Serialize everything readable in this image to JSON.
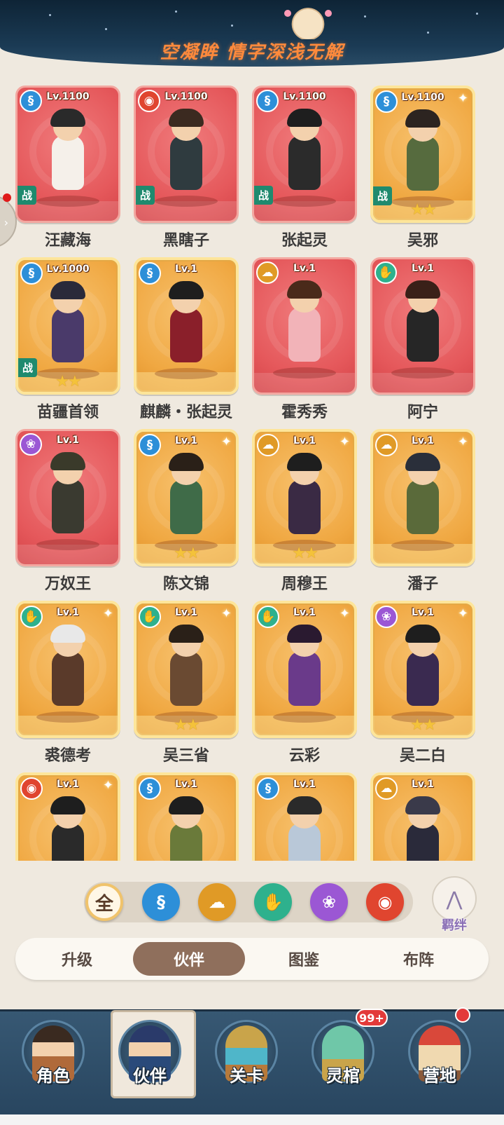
{
  "banner": {
    "title": "空凝眸 情字深浅无解"
  },
  "cards": [
    {
      "name": "汪藏海",
      "level": "Lv.1100",
      "element": "water",
      "bg": "red",
      "battle": true,
      "stars": 0,
      "sparkle": false,
      "hair": "#2a2a2a",
      "outfit": "#f5f0ea"
    },
    {
      "name": "黑瞎子",
      "level": "Lv.1100",
      "element": "fire",
      "bg": "red",
      "battle": true,
      "stars": 0,
      "sparkle": false,
      "hair": "#3b2a20",
      "outfit": "#2f3b3f"
    },
    {
      "name": "张起灵",
      "level": "Lv.1100",
      "element": "water",
      "bg": "red",
      "battle": true,
      "stars": 0,
      "sparkle": false,
      "hair": "#1e1e1e",
      "outfit": "#2b2b2b"
    },
    {
      "name": "吴邪",
      "level": "Lv.1100",
      "element": "water",
      "bg": "gold",
      "battle": true,
      "stars": 2,
      "sparkle": true,
      "hair": "#2c2420",
      "outfit": "#566b3e"
    },
    {
      "name": "苗疆首领",
      "level": "Lv.1000",
      "element": "water",
      "bg": "gold",
      "battle": true,
      "stars": 2,
      "sparkle": false,
      "hair": "#2a2a3a",
      "outfit": "#4a3a6a"
    },
    {
      "name": "麒麟・张起灵",
      "level": "Lv.1",
      "element": "water",
      "bg": "gold",
      "battle": false,
      "stars": 0,
      "sparkle": false,
      "hair": "#1e1e1e",
      "outfit": "#8a1f2a"
    },
    {
      "name": "霍秀秀",
      "level": "Lv.1",
      "element": "earth",
      "bg": "red",
      "battle": false,
      "stars": 0,
      "sparkle": false,
      "hair": "#4a2a1a",
      "outfit": "#f2b3b8"
    },
    {
      "name": "阿宁",
      "level": "Lv.1",
      "element": "wood",
      "bg": "red",
      "battle": false,
      "stars": 0,
      "sparkle": false,
      "hair": "#3a2018",
      "outfit": "#262626"
    },
    {
      "name": "万奴王",
      "level": "Lv.1",
      "element": "spirit",
      "bg": "red",
      "battle": false,
      "stars": 0,
      "sparkle": false,
      "hair": "#3a3a2a",
      "outfit": "#3a3a30"
    },
    {
      "name": "陈文锦",
      "level": "Lv.1",
      "element": "water",
      "bg": "gold",
      "battle": false,
      "stars": 2,
      "sparkle": true,
      "hair": "#2a2018",
      "outfit": "#3f6b48"
    },
    {
      "name": "周穆王",
      "level": "Lv.1",
      "element": "earth",
      "bg": "gold",
      "battle": false,
      "stars": 2,
      "sparkle": true,
      "hair": "#1e1e1e",
      "outfit": "#3a2a44"
    },
    {
      "name": "潘子",
      "level": "Lv.1",
      "element": "earth",
      "bg": "gold",
      "battle": false,
      "stars": 0,
      "sparkle": true,
      "hair": "#2a2f3a",
      "outfit": "#5a6a3a"
    },
    {
      "name": "裘德考",
      "level": "Lv.1",
      "element": "wood",
      "bg": "gold",
      "battle": false,
      "stars": 0,
      "sparkle": true,
      "hair": "#e8e8e8",
      "outfit": "#5a3a2a"
    },
    {
      "name": "吴三省",
      "level": "Lv.1",
      "element": "wood",
      "bg": "gold",
      "battle": false,
      "stars": 2,
      "sparkle": true,
      "hair": "#2a2018",
      "outfit": "#6a4a32"
    },
    {
      "name": "云彩",
      "level": "Lv.1",
      "element": "wood",
      "bg": "gold",
      "battle": false,
      "stars": 0,
      "sparkle": true,
      "hair": "#2a1a30",
      "outfit": "#6a3a8a"
    },
    {
      "name": "吴二白",
      "level": "Lv.1",
      "element": "spirit",
      "bg": "gold",
      "battle": false,
      "stars": 2,
      "sparkle": true,
      "hair": "#1e1e1e",
      "outfit": "#3a2a50"
    },
    {
      "name": "",
      "level": "Lv.1",
      "element": "fire",
      "bg": "gold",
      "battle": false,
      "stars": 0,
      "sparkle": true,
      "hair": "#1e1e1e",
      "outfit": "#2a2a2a"
    },
    {
      "name": "",
      "level": "Lv.1",
      "element": "water",
      "bg": "gold",
      "battle": false,
      "stars": 0,
      "sparkle": false,
      "hair": "#1e1e1e",
      "outfit": "#6a7a3a"
    },
    {
      "name": "",
      "level": "Lv.1",
      "element": "water",
      "bg": "gold",
      "battle": false,
      "stars": 0,
      "sparkle": false,
      "hair": "#2a2a2a",
      "outfit": "#b9c8d8"
    },
    {
      "name": "",
      "level": "Lv.1",
      "element": "earth",
      "bg": "gold",
      "battle": false,
      "stars": 0,
      "sparkle": false,
      "hair": "#3a3a4a",
      "outfit": "#2a2a3a"
    }
  ],
  "card_labels": {
    "battle": "战",
    "star": "★"
  },
  "element_icons": {
    "water": "water-dragon-icon",
    "fire": "fire-swirl-icon",
    "earth": "earth-cloud-icon",
    "wood": "wood-hand-icon",
    "spirit": "spirit-lotus-icon"
  },
  "element_glyphs": {
    "water": "§",
    "fire": "◉",
    "earth": "☁",
    "wood": "✋",
    "spirit": "❀"
  },
  "element_colors": {
    "water": "#2d8fd8",
    "fire": "#e0452f",
    "earth": "#e09a26",
    "wood": "#2eb18d",
    "spirit": "#9b57d4"
  },
  "filter": {
    "all_label": "全",
    "elements": [
      "water",
      "earth",
      "wood",
      "spirit",
      "fire"
    ]
  },
  "bond": {
    "label": "羁绊"
  },
  "subtabs": [
    {
      "label": "升级",
      "active": false
    },
    {
      "label": "伙伴",
      "active": true
    },
    {
      "label": "图鉴",
      "active": false
    },
    {
      "label": "布阵",
      "active": false
    }
  ],
  "bottom_nav": [
    {
      "label": "角色",
      "icon": "character-icon",
      "active": false,
      "badge": "",
      "dot": false
    },
    {
      "label": "伙伴",
      "icon": "partner-icon",
      "active": true,
      "badge": "",
      "dot": false
    },
    {
      "label": "关卡",
      "icon": "stage-icon",
      "active": false,
      "badge": "",
      "dot": false
    },
    {
      "label": "灵棺",
      "icon": "coffin-icon",
      "active": false,
      "badge": "99+",
      "dot": false
    },
    {
      "label": "营地",
      "icon": "camp-icon",
      "active": false,
      "badge": "",
      "dot": true
    }
  ],
  "accent": {
    "red_card": "#e5585b",
    "gold_card": "#f0a842",
    "active_tab": "#8f6f5c"
  }
}
